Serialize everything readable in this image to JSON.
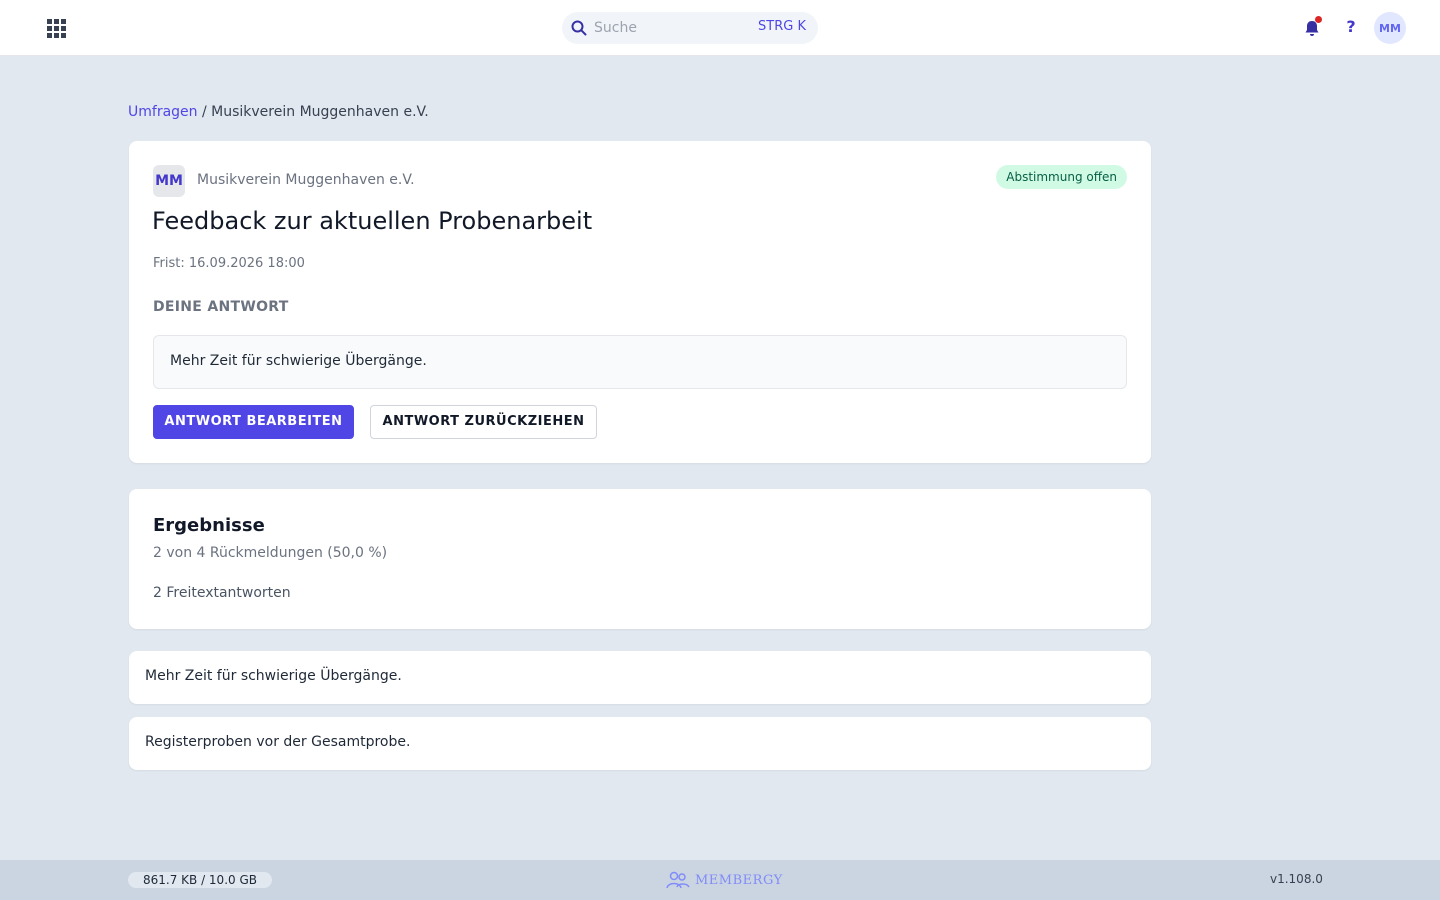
{
  "topbar": {
    "search_placeholder": "Suche",
    "search_shortcut": "STRG K",
    "help_label": "?",
    "user_initials": "MM"
  },
  "breadcrumb": {
    "parent": "Umfragen",
    "separator": "/",
    "current": "Musikverein Muggenhaven e.V."
  },
  "survey": {
    "org_initials": "MM",
    "org_name": "Musikverein Muggenhaven e.V.",
    "status": "Abstimmung offen",
    "title": "Feedback zur aktuellen Probenarbeit",
    "deadline": "Frist: 16.09.2026 18:00",
    "answer_label": "DEINE ANTWORT",
    "answer_text": "Mehr Zeit für schwierige Übergänge.",
    "edit_button": "ANTWORT BEARBEITEN",
    "withdraw_button": "ANTWORT ZURÜCKZIEHEN"
  },
  "results": {
    "title": "Ergebnisse",
    "count": "2 von 4 Rückmeldungen (50,0 %)",
    "freetext_count": "2 Freitextantworten",
    "answers": [
      "Mehr Zeit für schwierige Übergänge.",
      "Registerproben vor der Gesamtprobe."
    ]
  },
  "footer": {
    "storage": "861.7 KB / 10.0 GB",
    "storage_used_fraction": 0.0001,
    "brand": "MEMBERGY",
    "version": "v1.108.0"
  },
  "colors": {
    "accent": "#4f46e5",
    "badge_bg": "#d1fae5",
    "badge_text": "#065f46",
    "background": "#e2e8f0"
  }
}
